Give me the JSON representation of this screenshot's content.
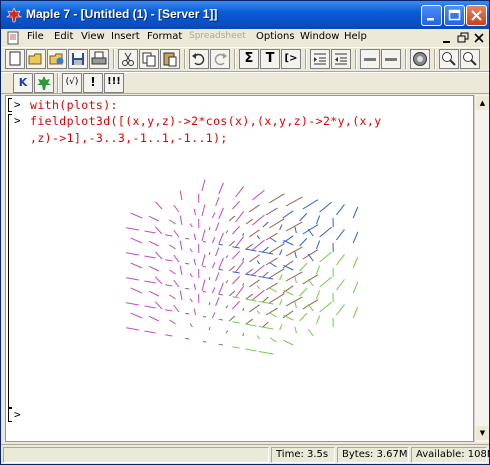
{
  "window": {
    "title": "Maple 7 - [Untitled (1) - [Server 1]]",
    "minimize": "minimize",
    "maximize": "maximize",
    "close": "close"
  },
  "menubar": {
    "items": [
      "File",
      "Edit",
      "View",
      "Insert",
      "Format",
      "Spreadsheet",
      "Options",
      "Window",
      "Help"
    ],
    "disabled": [
      "Spreadsheet"
    ]
  },
  "toolbar": {
    "sigma": "Σ",
    "text_t": "T",
    "exec_prompt": "[>",
    "stop": "!",
    "context1": "K",
    "fn": "(√)",
    "exclaim": "!",
    "exclaim_all": "!!!"
  },
  "document": {
    "prompts": [
      ">",
      ">",
      ">"
    ],
    "line1": "with(plots):",
    "line2a": "fieldplot3d([(x,y,z)->2*cos(x),(x,y,z)->2*y,(x,y",
    "line2b": ",z)->1],-3..3,-1..1,-1..1);"
  },
  "status": {
    "time": "Time: 3.5s",
    "bytes": "Bytes: 3.67M",
    "available": "Available: 108M"
  },
  "colors": {
    "input_text": "#e00000",
    "title_bar": "#0b5bd6",
    "field_magenta": "#c24ac8",
    "field_brown": "#9a5f4a",
    "field_blue": "#2f5fd8",
    "field_green": "#6fcf4a"
  }
}
